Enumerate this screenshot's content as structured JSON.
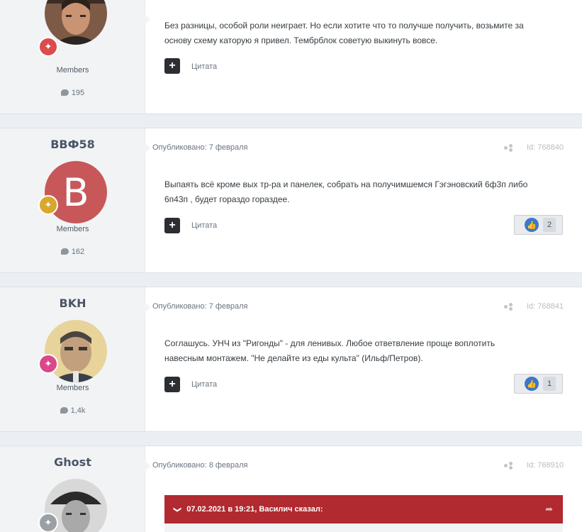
{
  "posts": [
    {
      "author": "",
      "group": "Members",
      "post_count": "195",
      "date": "",
      "id": "",
      "text_lines": [
        "Без разницы, особой роли неиграет. Но если хотите что то получше получить, возьмите за",
        "основу схему каторую я привел. Тембрблок советую выкинуть вовсе."
      ],
      "quote_label": "Цитата",
      "reactions": ""
    },
    {
      "author": "BBФ58",
      "avatar_letter": "B",
      "group": "Members",
      "post_count": "162",
      "date": "Опубликовано: 7 февраля",
      "id": "Id: 768840",
      "text_lines": [
        "Выпаять всё кроме вых тр-ра и панелек, собрать на получимшемся Гэгэновский 6ф3п либо",
        "6п43п , будет гораздо гораздее."
      ],
      "quote_label": "Цитата",
      "reactions": "2"
    },
    {
      "author": "BKH",
      "group": "Members",
      "post_count": "1,4k",
      "date": "Опубликовано: 7 февраля",
      "id": "Id: 768841",
      "text_lines": [
        "Соглашусь. УНЧ из \"Ригонды\" - для ленивых. Любое ответвление проще воплотить",
        "навесным монтажем.  \"Не делайте из еды культа\" (Ильф/Петров)."
      ],
      "quote_label": "Цитата",
      "reactions": "1"
    },
    {
      "author": "Ghost",
      "date": "Опубликовано: 8 февраля",
      "id": "Id: 768910",
      "quote_header": "07.02.2021 в 19:21, Василич сказал:"
    }
  ],
  "colors": {
    "page_bg": "#ebeef2",
    "sidebar_bg": "#f1f3f5",
    "quote_header": "#b02a30",
    "like_blue": "#3d77c9",
    "avatar_b": "#c8575a"
  },
  "icons": [
    "comment-bubble-icon",
    "plus-icon",
    "share-icon",
    "thumbs-up-icon",
    "chevron-down-icon",
    "reply-arrow-icon",
    "rank-badge-icon"
  ]
}
